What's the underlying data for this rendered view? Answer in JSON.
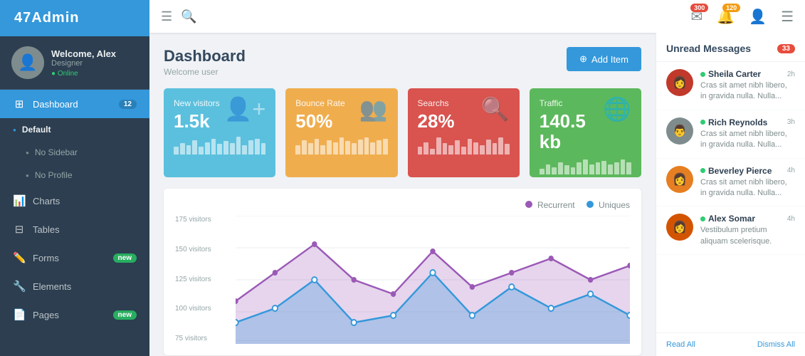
{
  "brand": "47Admin",
  "sidebar": {
    "profile": {
      "name": "Welcome, Alex",
      "role": "Designer",
      "status": "Online"
    },
    "nav": [
      {
        "id": "dashboard",
        "label": "Dashboard",
        "icon": "⊞",
        "badge": "12",
        "active": true
      },
      {
        "id": "default",
        "label": "Default",
        "type": "subheader"
      },
      {
        "id": "no-sidebar",
        "label": "No Sidebar",
        "type": "subitem"
      },
      {
        "id": "no-profile",
        "label": "No Profile",
        "type": "subitem"
      },
      {
        "id": "charts",
        "label": "Charts",
        "icon": "📊"
      },
      {
        "id": "tables",
        "label": "Tables",
        "icon": "⊟"
      },
      {
        "id": "forms",
        "label": "Forms",
        "icon": "✏️",
        "badge": "new",
        "badgeGreen": true
      },
      {
        "id": "elements",
        "label": "Elements",
        "icon": "🔧"
      },
      {
        "id": "pages",
        "label": "Pages",
        "icon": "📄",
        "badge": "new",
        "badgeGreen": true
      }
    ]
  },
  "topbar": {
    "menu_icon": "≡",
    "search_icon": "🔍",
    "notif_email_count": "300",
    "notif_bell_count": "120",
    "user_icon": "👤",
    "more_icon": "≡"
  },
  "page": {
    "title": "Dashboard",
    "subtitle": "Welcome user",
    "add_button": "Add Item"
  },
  "stat_cards": [
    {
      "id": "new-visitors",
      "label": "New visitors",
      "value": "1.5k",
      "color": "blue",
      "icon": "➕👤",
      "bars": [
        3,
        5,
        4,
        6,
        3,
        5,
        7,
        4,
        6,
        5,
        8,
        4,
        6,
        7,
        5
      ]
    },
    {
      "id": "bounce-rate",
      "label": "Bounce Rate",
      "value": "50%",
      "color": "yellow",
      "icon": "👥",
      "bars": [
        4,
        6,
        5,
        7,
        4,
        6,
        5,
        7,
        6,
        5,
        6,
        7,
        5,
        6,
        7
      ]
    },
    {
      "id": "searchs",
      "label": "Searchs",
      "value": "28%",
      "color": "red",
      "icon": "🔍",
      "bars": [
        3,
        5,
        2,
        7,
        5,
        4,
        6,
        3,
        7,
        5,
        4,
        6,
        5,
        7,
        4
      ]
    },
    {
      "id": "traffic",
      "label": "Traffic",
      "value": "140.5 kb",
      "color": "green",
      "icon": "🌐",
      "bars": [
        2,
        4,
        3,
        5,
        4,
        3,
        5,
        6,
        4,
        5,
        6,
        4,
        5,
        6,
        5
      ]
    }
  ],
  "chart": {
    "y_labels": [
      "175 visitors",
      "150 visitors",
      "125 visitors",
      "100 visitors",
      "75 visitors"
    ],
    "legend": [
      {
        "label": "Recurrent",
        "color": "#9b59b6"
      },
      {
        "label": "Uniques",
        "color": "#3498db"
      }
    ]
  },
  "unread_messages": {
    "title": "Unread Messages",
    "badge": "33",
    "messages": [
      {
        "name": "Sheila Carter",
        "time": "2h",
        "text": "Cras sit amet nibh libero, in gravida nulla. Nulla...",
        "online": true,
        "avatar_color": "#e74c3c"
      },
      {
        "name": "Rich Reynolds",
        "time": "3h",
        "text": "Cras sit amet nibh libero, in gravida nulla. Nulla...",
        "online": true,
        "avatar_color": "#7f8c8d"
      },
      {
        "name": "Beverley Pierce",
        "time": "4h",
        "text": "Cras sit amet nibh libero, in gravida nulla. Nulla...",
        "online": true,
        "avatar_color": "#c0392b"
      },
      {
        "name": "Alex Somar",
        "time": "4h",
        "text": "Vestibulum pretium aliquam scelerisque.",
        "online": true,
        "avatar_color": "#e67e22"
      }
    ],
    "read_all": "Read All",
    "dismiss_all": "Dismiss All"
  }
}
